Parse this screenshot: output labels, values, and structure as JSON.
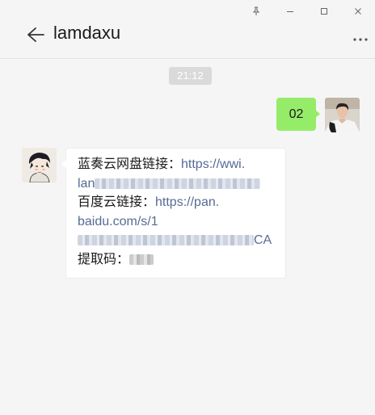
{
  "window": {
    "pin_icon": "pin-icon",
    "minimize_icon": "minimize-icon",
    "maximize_icon": "maximize-icon",
    "close_icon": "close-icon"
  },
  "header": {
    "title": "lamdaxu",
    "back_icon": "back-arrow-icon",
    "more_icon": "more-dots-icon"
  },
  "conversation": {
    "timestamp": "21:12",
    "messages": [
      {
        "sender": "self",
        "text": "02"
      },
      {
        "sender": "contact",
        "lines": [
          {
            "label": "蓝奏云网盘链接：",
            "link": "https://wwi."
          },
          {
            "link_prefix": "lan"
          },
          {
            "label": "百度云链接：",
            "link": "https://pan."
          },
          {
            "link": "baidu.com/s/1"
          },
          {
            "link_suffix": "CA"
          },
          {
            "label": "提取码："
          }
        ]
      }
    ]
  },
  "colors": {
    "background": "#f5f5f5",
    "sent_bubble": "#95ec69",
    "received_bubble": "#ffffff",
    "link": "#576b95",
    "timestamp_bg": "#dadada"
  }
}
